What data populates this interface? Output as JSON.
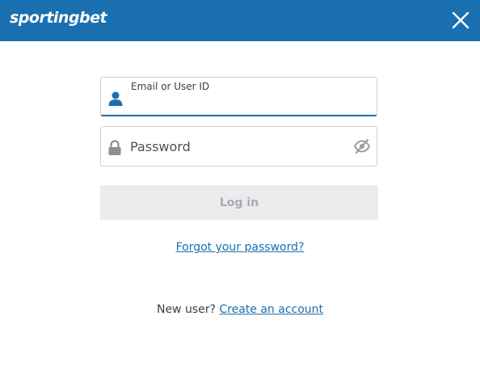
{
  "header": {
    "logo_text": "sportingbet",
    "close_icon": "close-icon",
    "background_color": "#1a6fb0"
  },
  "login_form": {
    "email_label": "Email or User ID",
    "email_value": "",
    "email_icon": "user-icon",
    "password_placeholder": "Password",
    "password_value": "",
    "password_icon": "lock-icon",
    "visibility_icon": "eye-off-icon",
    "login_button_label": "Log in",
    "forgot_link": "Forgot your password?",
    "new_user_text": "New user?",
    "create_account_link": "Create an account"
  },
  "colors": {
    "accent": "#1a6fb0",
    "icon_blue": "#1a6fb0",
    "icon_gray": "#8a8f94",
    "button_disabled_bg": "#e9ebed",
    "button_disabled_text": "#a7abaf"
  }
}
